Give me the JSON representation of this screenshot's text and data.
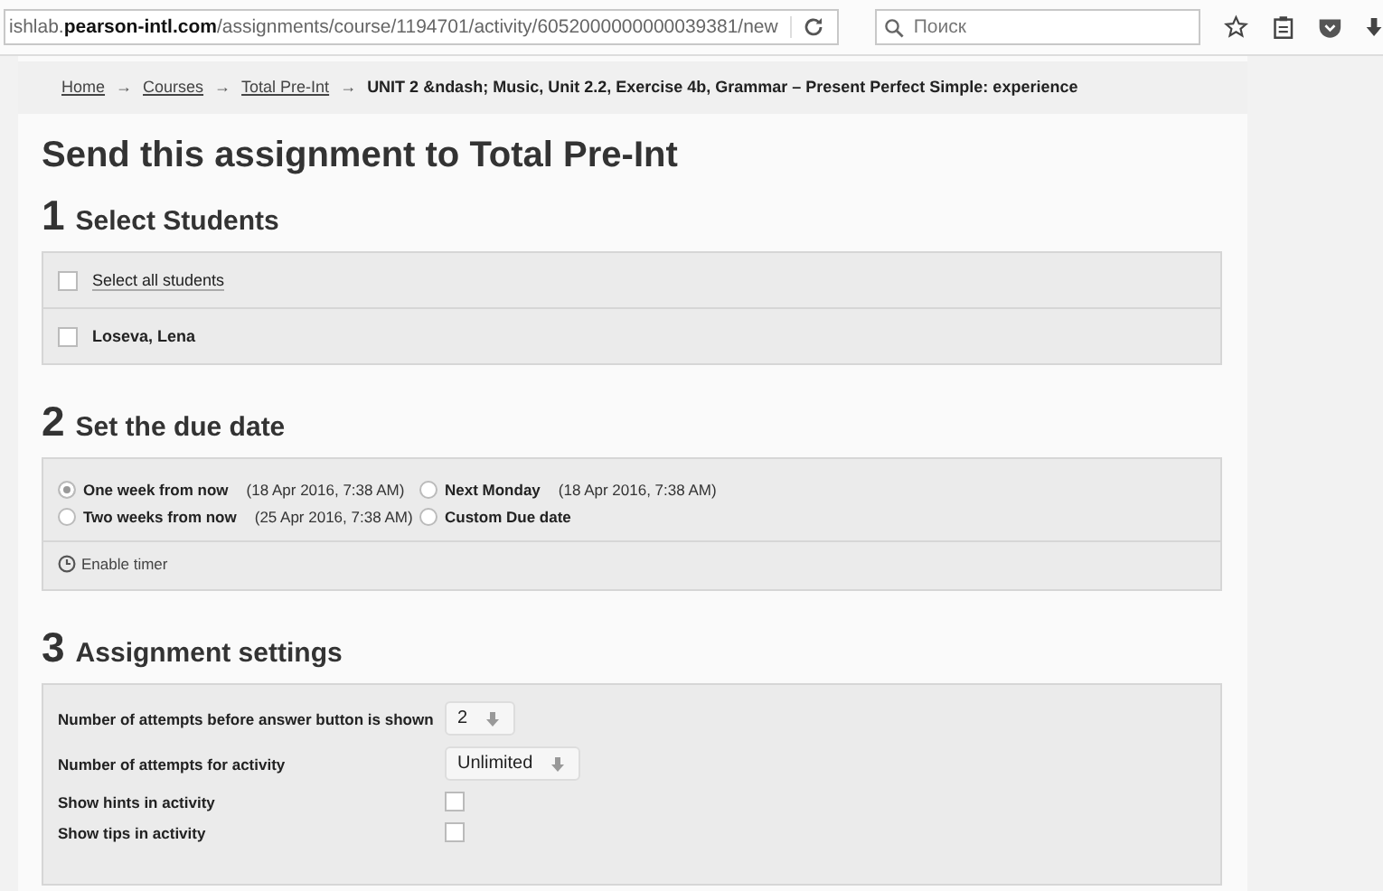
{
  "browser": {
    "url": "ishlab.**pearson-intl.com**/assignments/course/1194701/activity/6052000000000039381/new",
    "search": {
      "placeholder": "Поиск"
    }
  },
  "breadcrumb": [
    {
      "kind": "link",
      "text": "Home"
    },
    {
      "kind": "separator",
      "text": "→"
    },
    {
      "kind": "link",
      "text": "Courses"
    },
    {
      "kind": "separator",
      "text": "→"
    },
    {
      "kind": "link",
      "text": "Total Pre-Int"
    },
    {
      "kind": "separator",
      "text": "→"
    },
    {
      "kind": "current",
      "text": "UNIT 2 &ndash; Music, Unit 2.2, Exercise 4b, Grammar – Present Perfect Simple: experience"
    }
  ],
  "title": "Send this assignment to Total Pre-Int",
  "sections": [
    {
      "number": "1",
      "heading": "Select Students"
    },
    {
      "number": "2",
      "heading": "Set the due date"
    },
    {
      "number": "3",
      "heading": "Assignment settings"
    }
  ],
  "students": [
    {
      "kind": "all",
      "label": "Select all students",
      "checked": false
    },
    {
      "kind": "student",
      "label": "Loseva, Lena",
      "checked": false
    }
  ],
  "due_options": [
    {
      "label": "One week from now",
      "date": "(18 Apr 2016, 7:38 AM)",
      "selected": true
    },
    {
      "label": "Next Monday",
      "date": "(18 Apr 2016, 7:38 AM)",
      "selected": false
    },
    {
      "label": "Two weeks from now",
      "date": "(25 Apr 2016, 7:38 AM)",
      "selected": false
    },
    {
      "label": "Custom Due date",
      "selected": false
    }
  ],
  "timer": {
    "label": "Enable timer"
  },
  "settings": [
    {
      "kind": "select",
      "label": "Number of attempts before answer button is shown",
      "value": "2"
    },
    {
      "kind": "select",
      "label": "Number of attempts for activity",
      "value": "Unlimited"
    },
    {
      "kind": "checkbox",
      "label": "Show hints in activity",
      "checked": false
    },
    {
      "kind": "checkbox",
      "label": "Show tips in activity",
      "checked": false
    }
  ]
}
